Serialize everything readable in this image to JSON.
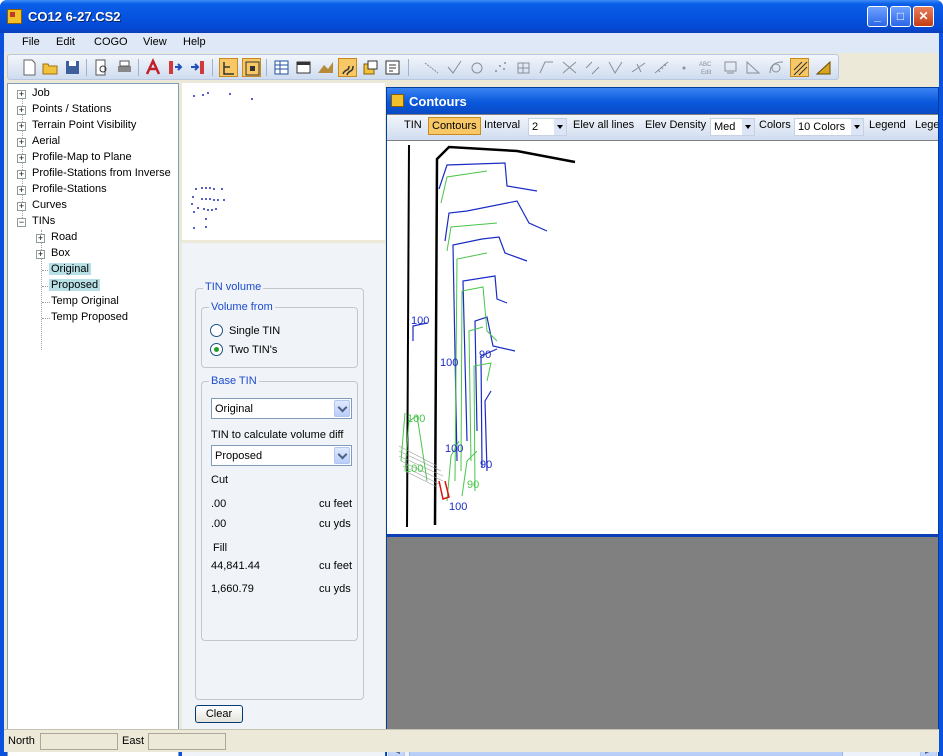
{
  "window": {
    "title": "CO12 6-27.CS2"
  },
  "menu": [
    "File",
    "Edit",
    "COGO",
    "View",
    "Help"
  ],
  "tree": {
    "items": [
      "Job",
      "Points / Stations",
      "Terrain Point Visibility",
      "Aerial",
      "Profile-Map to Plane",
      "Profile-Stations from Inverse",
      "Profile-Stations",
      "Curves",
      "TINs"
    ],
    "tins_children": [
      "Road",
      "Box",
      "Original",
      "Proposed",
      "Temp Original",
      "Temp Proposed"
    ]
  },
  "tin_volume": {
    "group_title": "TIN volume",
    "volume_from_title": "Volume from",
    "option_single": "Single TIN",
    "option_two": "Two TIN's",
    "base_tin_title": "Base TIN",
    "base_tin_value": "Original",
    "diff_label": "TIN to calculate volume diff",
    "diff_value": "Proposed",
    "cut_label": "Cut",
    "cut_feet": ".00",
    "cut_yds": ".00",
    "fill_label": "Fill",
    "fill_feet": "44,841.44",
    "fill_yds": "1,660.79",
    "unit_feet": "cu feet",
    "unit_yds": "cu yds",
    "clear_label": "Clear"
  },
  "contours": {
    "title": "Contours",
    "toolbar": {
      "tin": "TIN",
      "contours": "Contours",
      "interval_label": "Interval",
      "interval_value": "2",
      "elev_all_lines": "Elev all lines",
      "elev_density_label": "Elev Density",
      "elev_density_value": "Med",
      "colors_label": "Colors",
      "colors_value": "10 Colors",
      "legend": "Legend",
      "legend_cut": "Lege"
    },
    "labels": [
      "100",
      "100",
      "90",
      "100",
      "100",
      "90",
      "90",
      "100",
      "100"
    ]
  },
  "status": {
    "north_label": "North",
    "east_label": "East"
  }
}
